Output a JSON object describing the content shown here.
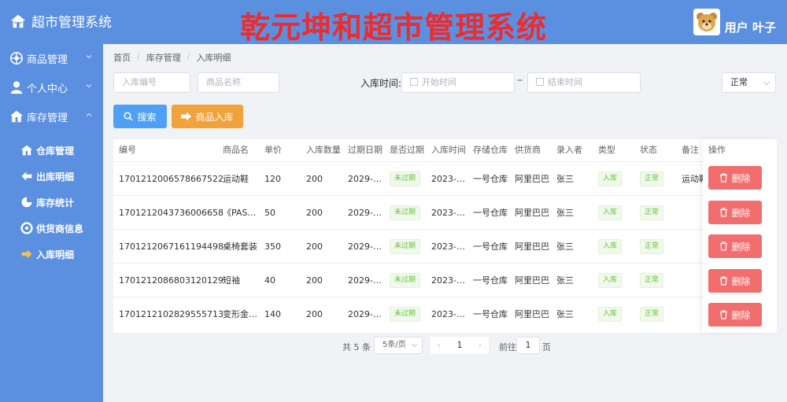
{
  "header": {
    "brand_title": "超市管理系统",
    "big_title": "乾元坤和超市管理系统",
    "user_name": "用户 叶子",
    "accent_color": "#5b8fe0",
    "title_color": "#ef2b2b"
  },
  "sidebar": {
    "menus": [
      {
        "label": "商品管理",
        "icon": "goods-icon",
        "expanded": false
      },
      {
        "label": "个人中心",
        "icon": "user-icon",
        "expanded": false
      },
      {
        "label": "库存管理",
        "icon": "warehouse-icon",
        "expanded": true
      }
    ],
    "sub_items": [
      {
        "label": "仓库管理",
        "icon": "home-icon"
      },
      {
        "label": "出库明细",
        "icon": "arrow-left-icon"
      },
      {
        "label": "库存统计",
        "icon": "chart-icon"
      },
      {
        "label": "供货商信息",
        "icon": "supplier-icon"
      },
      {
        "label": "入库明细",
        "icon": "arrow-right-icon"
      }
    ]
  },
  "breadcrumb": [
    "首页",
    "库存管理",
    "入库明细"
  ],
  "filters": {
    "inbound_no_placeholder": "入库编号",
    "product_name_placeholder": "商品名称",
    "time_label": "入库时间:",
    "start_placeholder": "开始时间",
    "end_placeholder": "结束时间",
    "range_sep": "–",
    "status_value": "正常"
  },
  "buttons": {
    "search": "搜索",
    "inbound": "商品入库",
    "delete": "删除"
  },
  "table": {
    "columns": [
      "编号",
      "商品名",
      "单价",
      "入库数量",
      "过期日期",
      "是否过期",
      "入库时间",
      "存储仓库",
      "供货商",
      "录入者",
      "类型",
      "状态",
      "备注",
      "操作"
    ],
    "rows": [
      [
        "1701212006578667522",
        "运动鞋",
        "120",
        "200",
        "2029-…",
        "未过期",
        "2023-…",
        "一号仓库",
        "阿里巴巴",
        "张三",
        "入库",
        "正常",
        "运动鞋"
      ],
      [
        "1701212043736006658",
        "《PAS…",
        "50",
        "200",
        "2029-…",
        "未过期",
        "2023-…",
        "一号仓库",
        "阿里巴巴",
        "张三",
        "入库",
        "正常",
        ""
      ],
      [
        "1701212067161194498",
        "桌椅套装",
        "350",
        "200",
        "2029-…",
        "未过期",
        "2023-…",
        "一号仓库",
        "阿里巴巴",
        "张三",
        "入库",
        "正常",
        ""
      ],
      [
        "1701212086803120129",
        "短袖",
        "40",
        "200",
        "2029-…",
        "未过期",
        "2023-…",
        "一号仓库",
        "阿里巴巴",
        "张三",
        "入库",
        "正常",
        ""
      ],
      [
        "1701212102829555713",
        "变形金…",
        "140",
        "200",
        "2029-…",
        "未过期",
        "2023-…",
        "一号仓库",
        "阿里巴巴",
        "张三",
        "入库",
        "正常",
        ""
      ]
    ]
  },
  "pagination": {
    "total": "共 5 条",
    "page_size": "5条/页",
    "prev": "‹",
    "current": "1",
    "next": "›",
    "goto_label": "前往",
    "goto_value": "1",
    "page_suffix": "页"
  }
}
